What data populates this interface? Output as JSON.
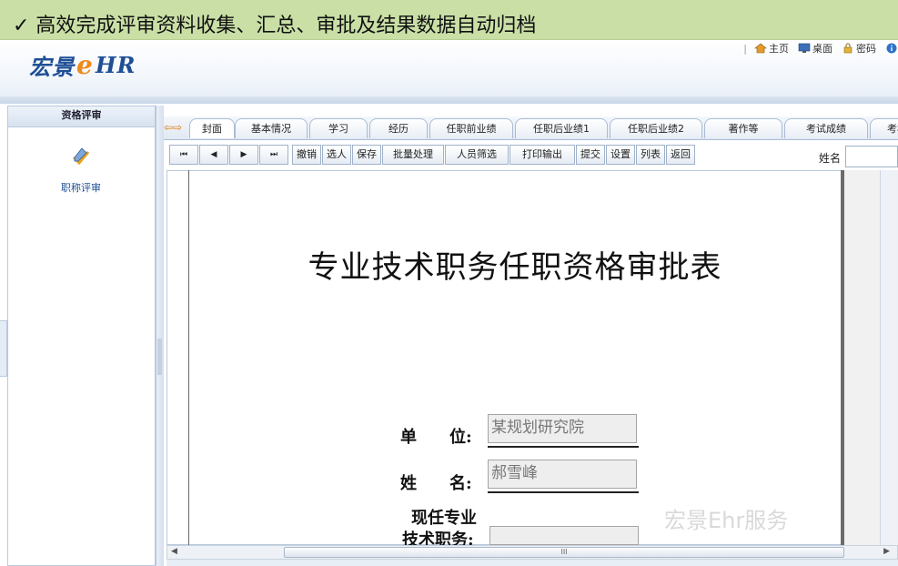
{
  "banner": {
    "text": "✓ 高效完成评审资料收集、汇总、审批及结果数据自动归档"
  },
  "header": {
    "logo_brand": "宏景",
    "logo_e": "e",
    "logo_hr": "HR",
    "links": [
      {
        "label": "主页",
        "icon": "home-icon"
      },
      {
        "label": "桌面",
        "icon": "desktop-icon"
      },
      {
        "label": "密码",
        "icon": "lock-icon"
      }
    ]
  },
  "sidebar": {
    "header": "资格评审",
    "items": [
      {
        "label": "职称评审",
        "icon": "review-pen-icon"
      }
    ]
  },
  "tabs": [
    {
      "label": "封面",
      "active": true
    },
    {
      "label": "基本情况"
    },
    {
      "label": "学习"
    },
    {
      "label": "经历"
    },
    {
      "label": "任职前业绩"
    },
    {
      "label": "任职后业绩1"
    },
    {
      "label": "任职后业绩2"
    },
    {
      "label": "著作等"
    },
    {
      "label": "考试成绩"
    },
    {
      "label": "考核"
    }
  ],
  "toolbar": {
    "nav": [
      "⏮",
      "◀",
      "▶",
      "⏭"
    ],
    "buttons": [
      "撤销",
      "选人",
      "保存",
      "批量处理",
      "人员筛选",
      "打印输出",
      "提交",
      "设置",
      "列表",
      "返回"
    ],
    "name_label": "姓名",
    "name_value": ""
  },
  "document": {
    "title": "专业技术职务任职资格审批表",
    "fields": [
      {
        "label": "单　　位:",
        "value": "某规划研究院"
      },
      {
        "label": "姓　　名:",
        "value": "郝雪峰"
      },
      {
        "label_line1": "现任专业",
        "label_line2": "技术职务:",
        "value": ""
      }
    ],
    "watermark": "宏景Ehr服务"
  },
  "scrollbar": {
    "thumb_label": "III"
  }
}
